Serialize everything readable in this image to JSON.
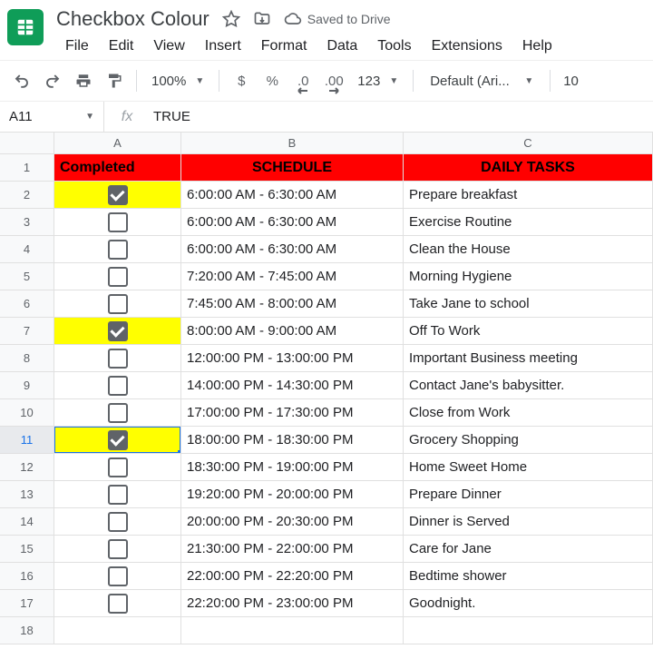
{
  "doc": {
    "title": "Checkbox Colour",
    "saved_status": "Saved to Drive"
  },
  "menu": {
    "file": "File",
    "edit": "Edit",
    "view": "View",
    "insert": "Insert",
    "format": "Format",
    "data": "Data",
    "tools": "Tools",
    "extensions": "Extensions",
    "help": "Help"
  },
  "toolbar": {
    "zoom": "100%",
    "currency": "$",
    "percent": "%",
    "dec_dec": ".0",
    "inc_dec": ".00",
    "more_formats": "123",
    "font_name": "Default (Ari...",
    "font_size": "10"
  },
  "namebox": {
    "ref": "A11"
  },
  "fx": {
    "value": "TRUE"
  },
  "columns": {
    "A": "A",
    "B": "B",
    "C": "C"
  },
  "headers": {
    "completed": "Completed",
    "schedule": "SCHEDULE",
    "tasks": "DAILY TASKS"
  },
  "rows": [
    {
      "n": 1
    },
    {
      "n": 2,
      "checked": true,
      "hl": true,
      "schedule": "6:00:00 AM - 6:30:00 AM",
      "task": "Prepare breakfast"
    },
    {
      "n": 3,
      "checked": false,
      "hl": false,
      "schedule": "6:00:00 AM - 6:30:00 AM",
      "task": "Exercise Routine"
    },
    {
      "n": 4,
      "checked": false,
      "hl": false,
      "schedule": "6:00:00 AM - 6:30:00 AM",
      "task": "Clean the House"
    },
    {
      "n": 5,
      "checked": false,
      "hl": false,
      "schedule": "7:20:00 AM - 7:45:00 AM",
      "task": "Morning Hygiene"
    },
    {
      "n": 6,
      "checked": false,
      "hl": false,
      "schedule": "7:45:00 AM - 8:00:00 AM",
      "task": "Take Jane to school"
    },
    {
      "n": 7,
      "checked": true,
      "hl": true,
      "schedule": "8:00:00 AM - 9:00:00 AM",
      "task": "Off To Work"
    },
    {
      "n": 8,
      "checked": false,
      "hl": false,
      "schedule": "12:00:00 PM - 13:00:00 PM",
      "task": "Important Business meeting"
    },
    {
      "n": 9,
      "checked": false,
      "hl": false,
      "schedule": "14:00:00 PM - 14:30:00 PM",
      "task": "Contact Jane's babysitter."
    },
    {
      "n": 10,
      "checked": false,
      "hl": false,
      "schedule": "17:00:00 PM - 17:30:00 PM",
      "task": "Close from Work"
    },
    {
      "n": 11,
      "checked": true,
      "hl": true,
      "schedule": "18:00:00 PM - 18:30:00 PM",
      "task": "Grocery Shopping",
      "active": true
    },
    {
      "n": 12,
      "checked": false,
      "hl": false,
      "schedule": "18:30:00 PM - 19:00:00 PM",
      "task": "Home Sweet Home"
    },
    {
      "n": 13,
      "checked": false,
      "hl": false,
      "schedule": "19:20:00 PM - 20:00:00 PM",
      "task": "Prepare Dinner"
    },
    {
      "n": 14,
      "checked": false,
      "hl": false,
      "schedule": "20:00:00 PM - 20:30:00 PM",
      "task": "Dinner is Served"
    },
    {
      "n": 15,
      "checked": false,
      "hl": false,
      "schedule": "21:30:00 PM - 22:00:00 PM",
      "task": "Care for Jane"
    },
    {
      "n": 16,
      "checked": false,
      "hl": false,
      "schedule": "22:00:00 PM - 22:20:00 PM",
      "task": "Bedtime shower"
    },
    {
      "n": 17,
      "checked": false,
      "hl": false,
      "schedule": "22:20:00 PM - 23:00:00 PM",
      "task": "Goodnight."
    },
    {
      "n": 18,
      "empty": true
    }
  ]
}
